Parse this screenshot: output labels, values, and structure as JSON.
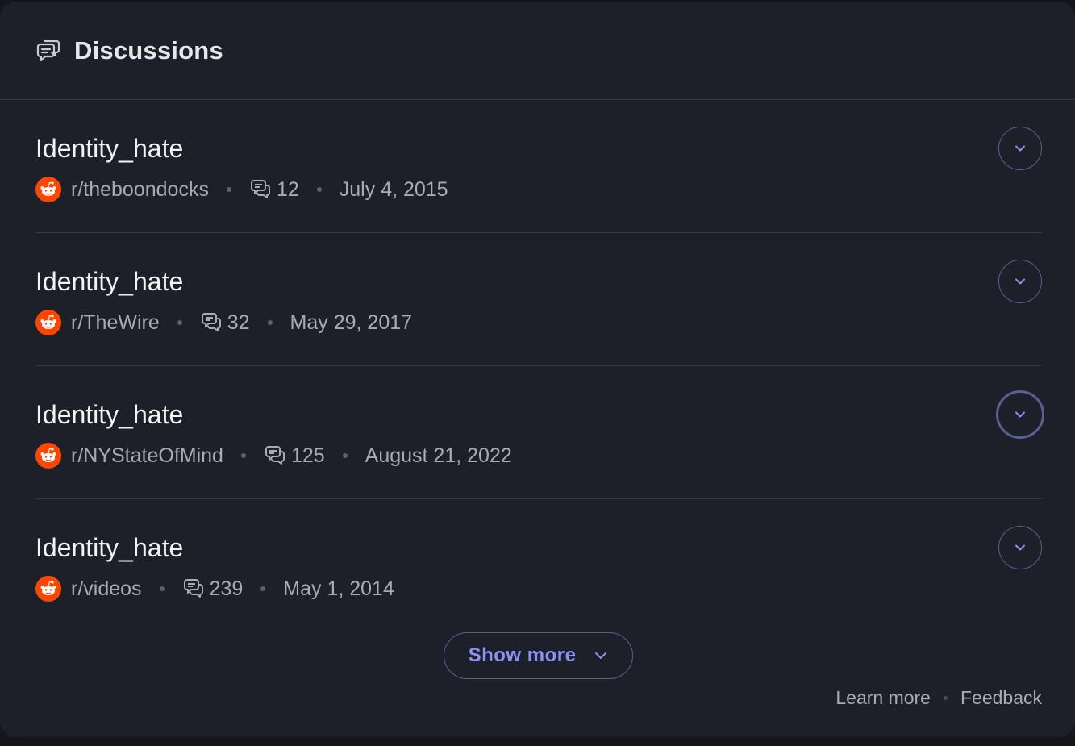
{
  "header": {
    "title": "Discussions",
    "icon": "discussions-icon"
  },
  "discussions": [
    {
      "title": "Identity_hate",
      "subreddit": "r/theboondocks",
      "comments": "12",
      "date": "July 4, 2015"
    },
    {
      "title": "Identity_hate",
      "subreddit": "r/TheWire",
      "comments": "32",
      "date": "May 29, 2017"
    },
    {
      "title": "Identity_hate",
      "subreddit": "r/NYStateOfMind",
      "comments": "125",
      "date": "August 21, 2022"
    },
    {
      "title": "Identity_hate",
      "subreddit": "r/videos",
      "comments": "239",
      "date": "May 1, 2014"
    }
  ],
  "show_more_label": "Show more",
  "footer": {
    "learn_more": "Learn more",
    "feedback": "Feedback"
  },
  "colors": {
    "background": "#1e2029",
    "accent": "#8d91f2",
    "reddit": "#ff4500"
  }
}
